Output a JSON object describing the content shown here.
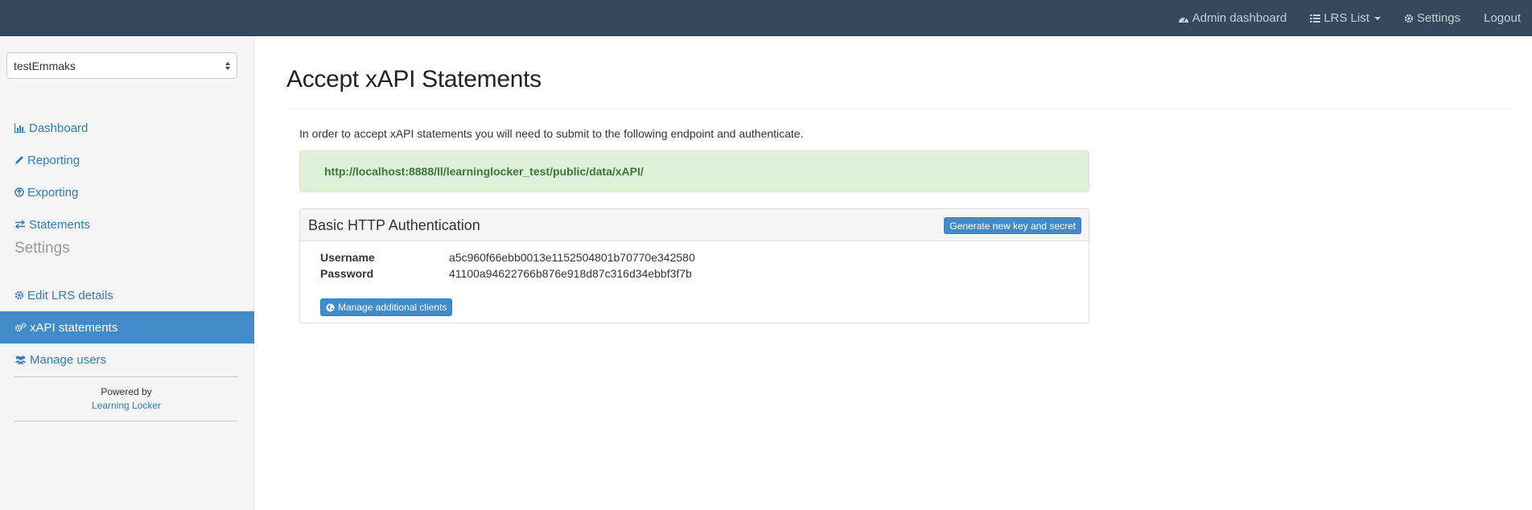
{
  "topbar": {
    "items": [
      {
        "label": "Admin dashboard",
        "icon": "dashboard-icon"
      },
      {
        "label": "LRS List",
        "icon": "list-icon"
      },
      {
        "label": "Settings",
        "icon": "gear-icon"
      },
      {
        "label": "Logout"
      }
    ]
  },
  "sidebar": {
    "lrs_select": "testEmmaks",
    "links": [
      {
        "label": "Dashboard",
        "icon": "bar-chart-icon"
      },
      {
        "label": "Reporting",
        "icon": "pencil-icon"
      },
      {
        "label": "Exporting",
        "icon": "export-circle-icon"
      },
      {
        "label": "Statements",
        "icon": "exchange-icon"
      }
    ],
    "settings_heading": "Settings",
    "settings_links": [
      {
        "label": "Edit LRS details",
        "icon": "gear-icon"
      },
      {
        "label": "xAPI statements",
        "icon": "gears-icon",
        "active": true
      },
      {
        "label": "Manage users",
        "icon": "users-icon"
      }
    ],
    "powered_by": "Powered by",
    "powered_link": "Learning Locker"
  },
  "main": {
    "title": "Accept xAPI Statements",
    "intro": "In order to accept xAPI statements you will need to submit to the following endpoint and authenticate.",
    "endpoint": "http://localhost:8888/ll/learninglocker_test/public/data/xAPI/",
    "auth_panel": {
      "title": "Basic HTTP Authentication",
      "generate_button": "Generate new key and secret",
      "username_label": "Username",
      "username_value": "a5c960f66ebb0013e1152504801b70770e342580",
      "password_label": "Password",
      "password_value": "41100a94622766b876e918d87c316d34ebbf3f7b",
      "manage_button": "Manage additional clients"
    }
  },
  "colors": {
    "topbar": "#34495e",
    "primary": "#428bca",
    "link": "#337ab7",
    "success_bg": "#dff0d8",
    "success_text": "#3c763d"
  }
}
